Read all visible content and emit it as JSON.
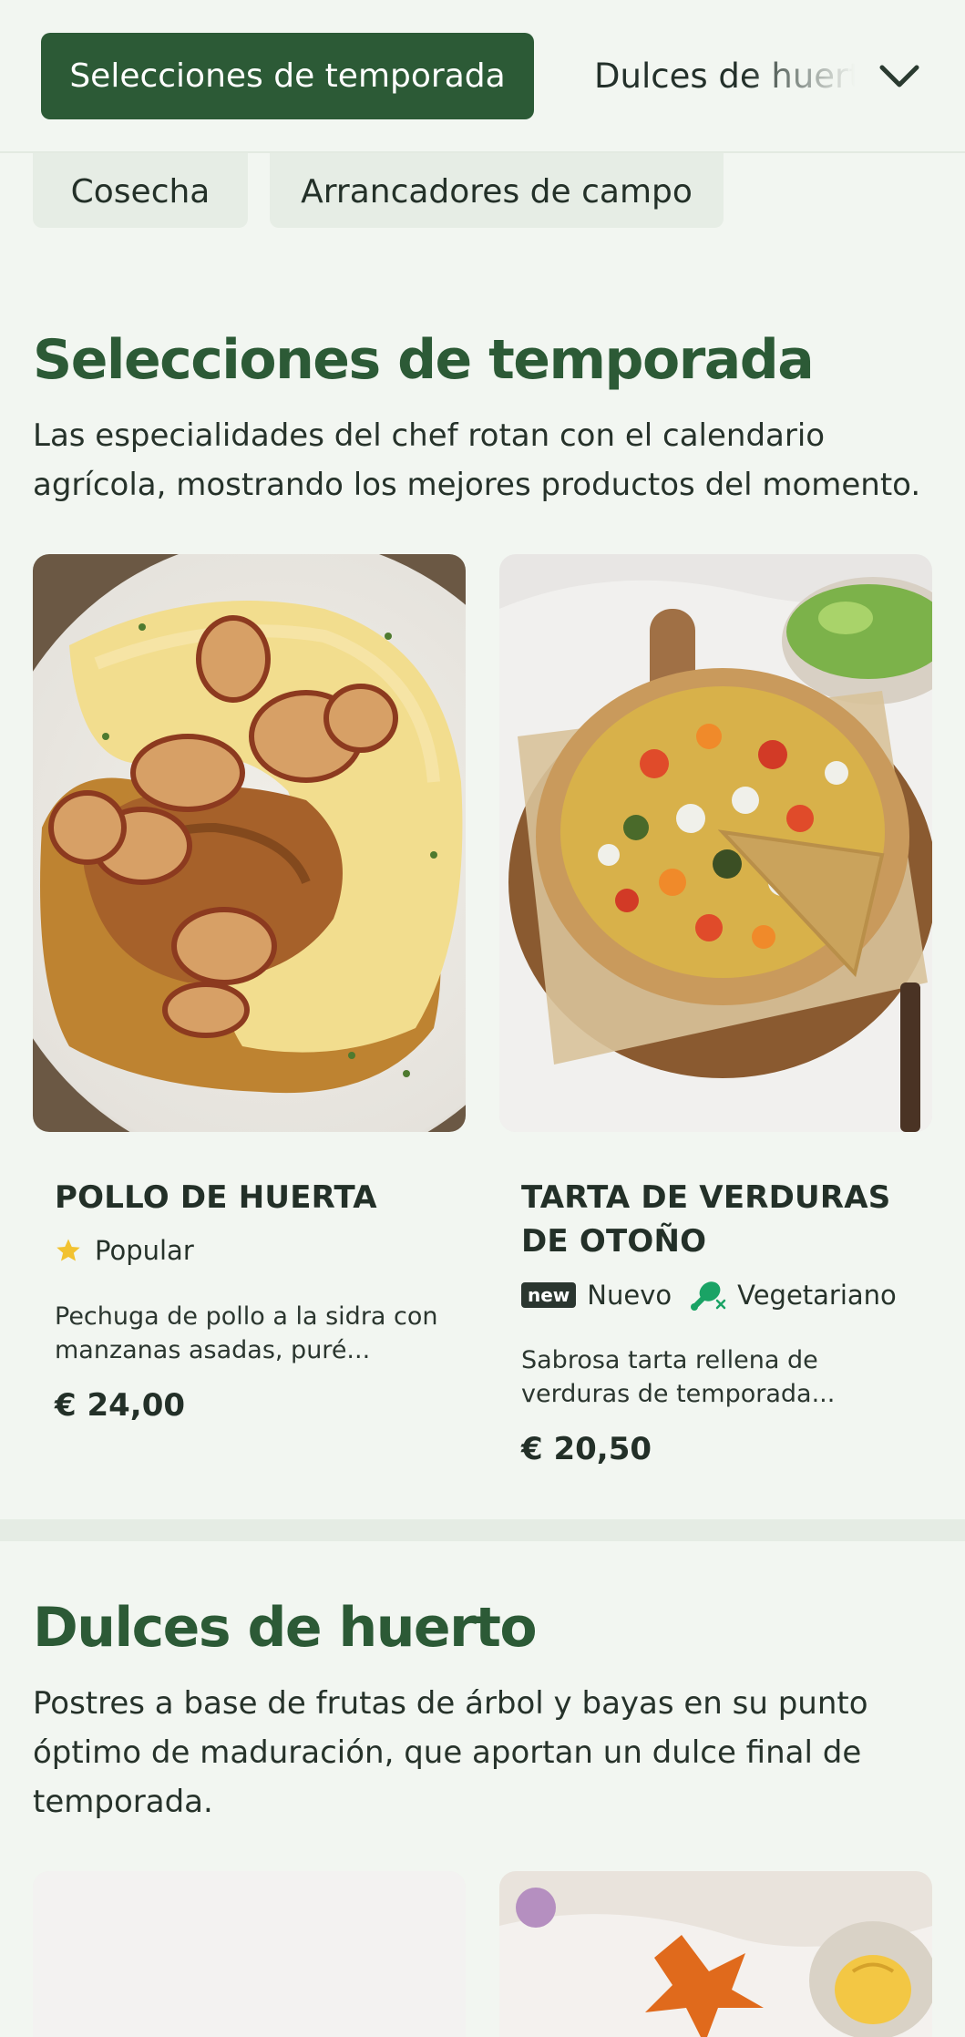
{
  "nav": {
    "active_tab": "Selecciones de temporada",
    "next_tab": "Dulces de huerto",
    "chips": [
      "Cosecha",
      "Arrancadores de campo"
    ],
    "expand_icon": "chevron-down-icon"
  },
  "sections": [
    {
      "title": "Selecciones de temporada",
      "description": "Las especialidades del chef rotan con el calendario agrícola, mostrando los mejores productos del momento.",
      "items": [
        {
          "name": "POLLO DE HUERTA",
          "badge_label": "Popular",
          "badge_icon": "star-icon",
          "description": "Pechuga de pollo a la sidra con manzanas asadas, puré...",
          "price": "€ 24,00"
        },
        {
          "name": "TARTA DE VERDURAS DE OTOÑO",
          "new_badge": "new",
          "new_label": "Nuevo",
          "diet_icon": "vegetarian-drumstick-crossed-icon",
          "diet_label": "Vegetariano",
          "description": "Sabrosa tarta rellena de verduras de temporada...",
          "price": "€ 20,50"
        }
      ]
    },
    {
      "title": "Dulces de huerto",
      "description": "Postres a base de frutas de árbol y bayas en su punto óptimo de maduración, que aportan un dulce final de temporada."
    }
  ],
  "colors": {
    "background": "#f2f6f1",
    "brand_green": "#2c5a36",
    "star_yellow": "#f2c230",
    "vegetarian_green": "#1aa365"
  }
}
